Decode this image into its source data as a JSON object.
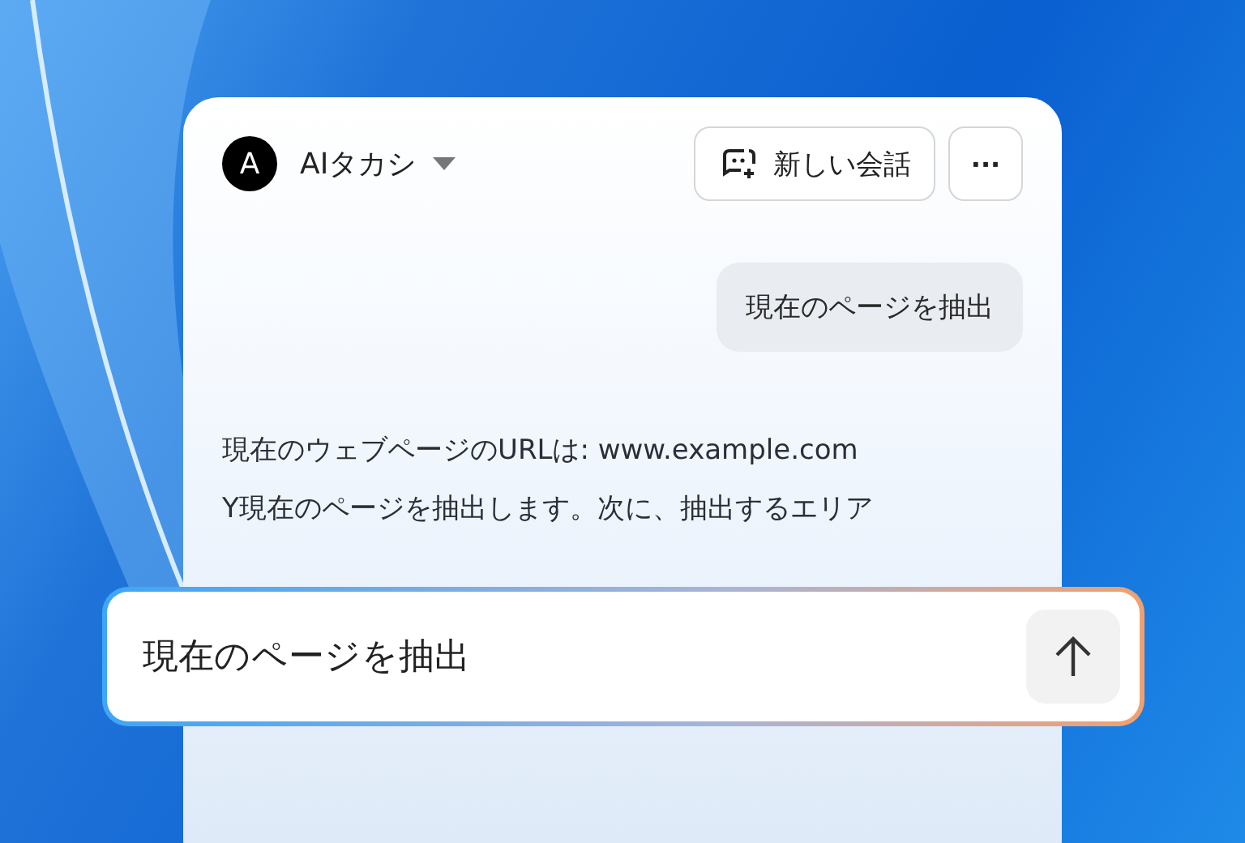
{
  "header": {
    "avatar_letter": "A",
    "assistant_name": "AIタカシ",
    "new_chat_button": "新しい会話",
    "more_button": "···"
  },
  "messages": [
    {
      "kind": "user",
      "text": "現在のページを抽出"
    },
    {
      "kind": "assistant",
      "paragraphs": [
        "現在のウェブページのURLは: www.example.com",
        "Y現在のページを抽出します。次に、抽出するエリア"
      ]
    }
  ],
  "composer": {
    "value": "現在のページを抽出"
  }
}
